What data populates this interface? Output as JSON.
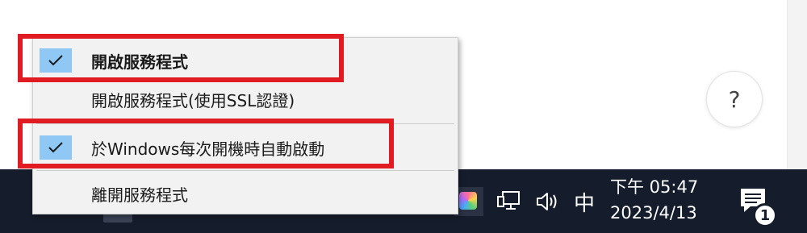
{
  "help": {
    "label": "?"
  },
  "menu": {
    "items": [
      {
        "label": "開啟服務程式",
        "checked": true,
        "bold": true
      },
      {
        "label": "開啟服務程式(使用SSL認證)",
        "checked": false,
        "bold": false
      },
      {
        "label": "於Windows每次開機時自動啟動",
        "checked": true,
        "bold": false
      },
      {
        "label": "離開服務程式",
        "checked": false,
        "bold": false
      }
    ]
  },
  "taskbar": {
    "ime": "中",
    "clock": {
      "time": "下午 05:47",
      "date": "2023/4/13"
    },
    "notification_count": "1"
  },
  "icons": {
    "check": "check-icon",
    "network": "network-icon",
    "volume": "volume-icon",
    "notification": "notification-icon",
    "tray_app": "app-tray-icon"
  },
  "colors": {
    "highlight": "#e01b22",
    "check_bg": "#8fc8f5",
    "taskbar": "#151d2c",
    "menu_bg": "#f2f2f2"
  }
}
